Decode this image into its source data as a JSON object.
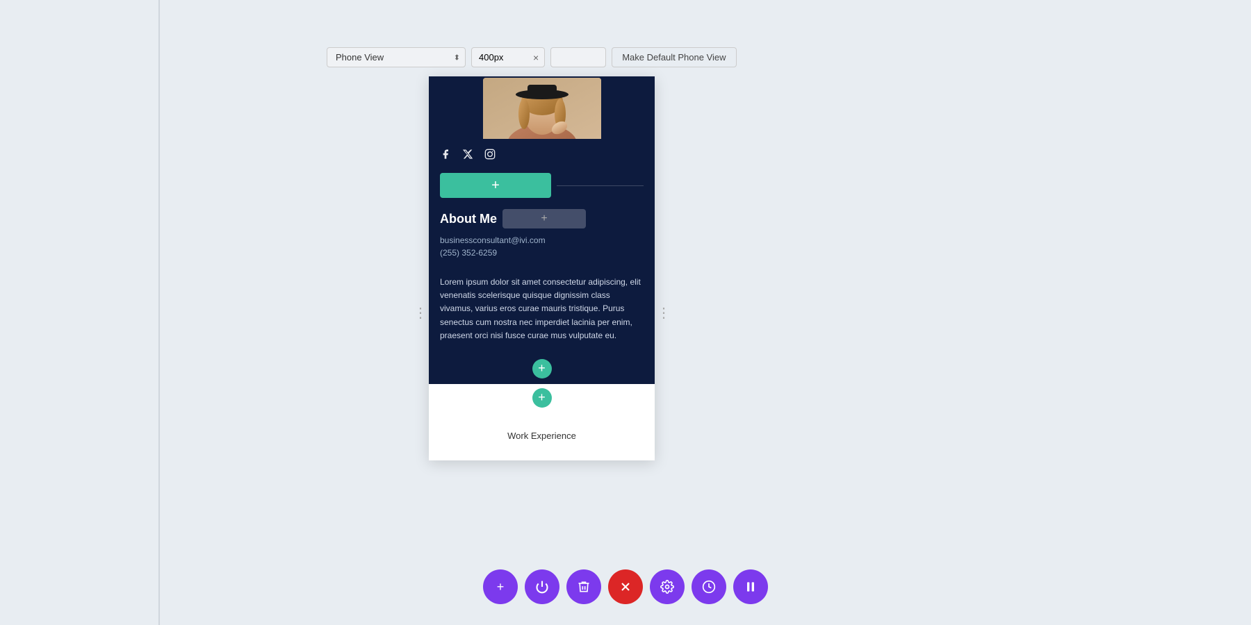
{
  "toolbar": {
    "view_select_label": "Phone View",
    "px_value": "400px",
    "make_default_label": "Make Default Phone View"
  },
  "profile": {
    "email": "businessconsultant@ivi.com",
    "phone": "(255) 352-6259",
    "bio": "Lorem ipsum dolor sit amet consectetur adipiscing, elit venenatis scelerisque quisque dignissim class vivamus, varius eros curae mauris tristique. Purus senectus cum nostra nec imperdiet lacinia per enim, praesent orci nisi fusce curae mus vulputate eu.",
    "about_title": "About Me"
  },
  "social": {
    "facebook_icon": "f",
    "twitter_icon": "✕",
    "instagram_icon": "◻"
  },
  "sections": {
    "work_experience": "Work Experience"
  },
  "bottom_toolbar": {
    "add_label": "+",
    "power_label": "⏻",
    "trash_label": "🗑",
    "close_label": "✕",
    "settings_label": "⚙",
    "history_label": "◷",
    "pause_label": "⏸"
  }
}
